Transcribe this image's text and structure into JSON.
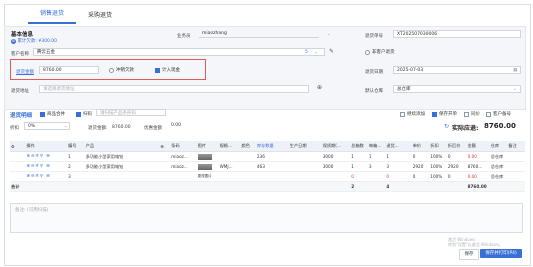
{
  "tabs": [
    "销售退货",
    "采购退货"
  ],
  "basic": {
    "title": "基本信息",
    "sub_badge": "Ⅲ",
    "sub_text": "累计欠款: ¥300.00",
    "salesman_label": "业务员",
    "salesman_value": "miaozhang",
    "order_no_label": "退货单号",
    "order_no_value": "XT202507030006",
    "customer_label": "客户名称",
    "customer_value": "腾云五金",
    "customer_badge": "5",
    "nonclient_label": "非客户退货",
    "refund_label": "退货金额",
    "refund_value": "8760.00",
    "offset_label": "冲销欠款",
    "stock_label": "计入现金",
    "date_label": "退货日期",
    "date_value": "2025-07-03",
    "addr_label": "退货地址",
    "addr_placeholder": "请选择退货地址",
    "warehouse_label": "默认仓库",
    "warehouse_value": "总仓库"
  },
  "detail": {
    "title": "退货明细",
    "opt_merge": "商品合并",
    "opt_scan": "扫码",
    "scan_placeholder": "请扫描产品条形码",
    "right_opts": [
      "继续添加",
      "保存开单",
      "同价",
      "客户备号"
    ],
    "discount_label": "折扣",
    "discount_value": "0%",
    "before_label": "退货金额:",
    "before_value": "8760.00",
    "extra_label": "优惠金额",
    "extra_value": "0.00",
    "total_label": "实际应退:",
    "total_value": "8760.00"
  },
  "table": {
    "headers": [
      "",
      "操作",
      "编号",
      "产品",
      "",
      "条码",
      "图片",
      "规格...",
      "颜色",
      "库存数量",
      "生产日期",
      "保质期(...",
      "总箱数",
      "每箱...",
      "退货...",
      "",
      "单价",
      "折扣",
      "折后价",
      "金额",
      "仓库",
      "备注"
    ],
    "rows": [
      {
        "op": "⊕⊖🗎⚲ ☰",
        "no": "1",
        "product": "多功能小型家用电钻",
        "code": "miaoz...",
        "spec": "",
        "color": "",
        "stock": "236",
        "date": "",
        "shelf": "3000",
        "boxes": "1",
        "per": "1",
        "qty": "1",
        "unit": "",
        "price": "0",
        "discount": "100%",
        "after": "0",
        "amount": "0.00",
        "wh": "总仓库",
        "remark": ""
      },
      {
        "op": "⊕⊖🗎⚲ ☰",
        "no": "2",
        "product": "多功能小型家用电钻",
        "code": "miaoz...",
        "spec": "WMJ...",
        "color": "",
        "stock": "463",
        "date": "",
        "shelf": "3000",
        "boxes": "1",
        "per": "3",
        "qty": "3",
        "unit": "",
        "price": "2920",
        "discount": "100%",
        "after": "2920",
        "amount": "8760...",
        "wh": "总仓库",
        "remark": ""
      },
      {
        "op": "⊕⊖🗎⚲ ☰",
        "no": "3",
        "product": "",
        "code": "",
        "spec": "",
        "color": "",
        "stock": "",
        "date": "",
        "shelf": "",
        "boxes": "0",
        "per": "",
        "qty": "0",
        "unit": "",
        "price": "0",
        "discount": "100%",
        "after": "0",
        "amount": "0.00",
        "wh": "总仓库",
        "remark": ""
      }
    ],
    "img_text": "更改图片",
    "sum_label": "合计",
    "sum_boxes": "2",
    "sum_qty": "4",
    "sum_amount": "8760.00"
  },
  "remark_placeholder": "备注: (可用扫描)",
  "watermark_1": "激活 Windows",
  "watermark_2": "转到\"设置\"以激活 Windows。",
  "buttons": {
    "save": "保存",
    "save_print": "保存并打印(P4)"
  },
  "colors": {
    "accent": "#3a6fd8",
    "alert": "#e05a5a"
  }
}
